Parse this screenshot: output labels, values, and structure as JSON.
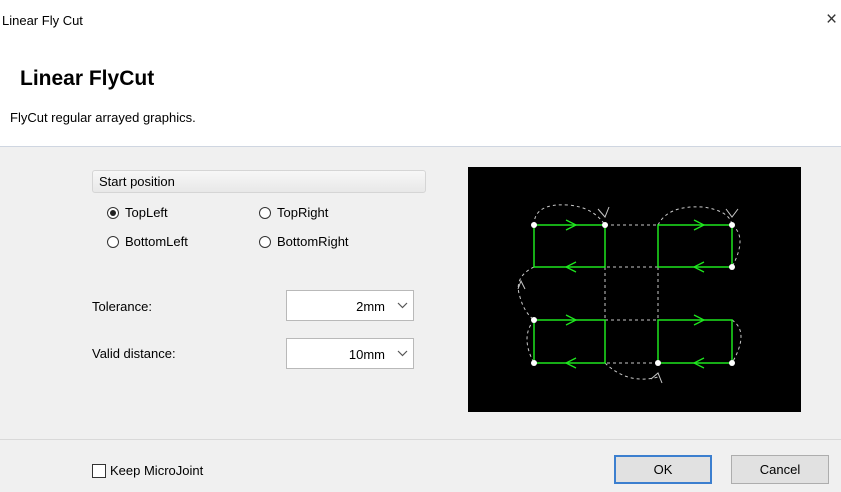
{
  "window": {
    "title": "Linear Fly Cut",
    "close_glyph": "×"
  },
  "header": {
    "title": "Linear FlyCut",
    "description": "FlyCut regular arrayed graphics."
  },
  "start_position": {
    "group_label": "Start position",
    "options": [
      {
        "label": "TopLeft",
        "selected": true
      },
      {
        "label": "TopRight",
        "selected": false
      },
      {
        "label": "BottomLeft",
        "selected": false
      },
      {
        "label": "BottomRight",
        "selected": false
      }
    ]
  },
  "tolerance": {
    "label": "Tolerance:",
    "value": "2mm"
  },
  "valid_distance": {
    "label": "Valid distance:",
    "value": "10mm"
  },
  "keep_microjoint": {
    "label": "Keep MicroJoint",
    "checked": false
  },
  "buttons": {
    "ok": "OK",
    "cancel": "Cancel"
  },
  "colors": {
    "accent": "#3c7fcf",
    "path": "#1ee61e",
    "travel": "#c8c8c8",
    "preview_bg": "#000000"
  }
}
